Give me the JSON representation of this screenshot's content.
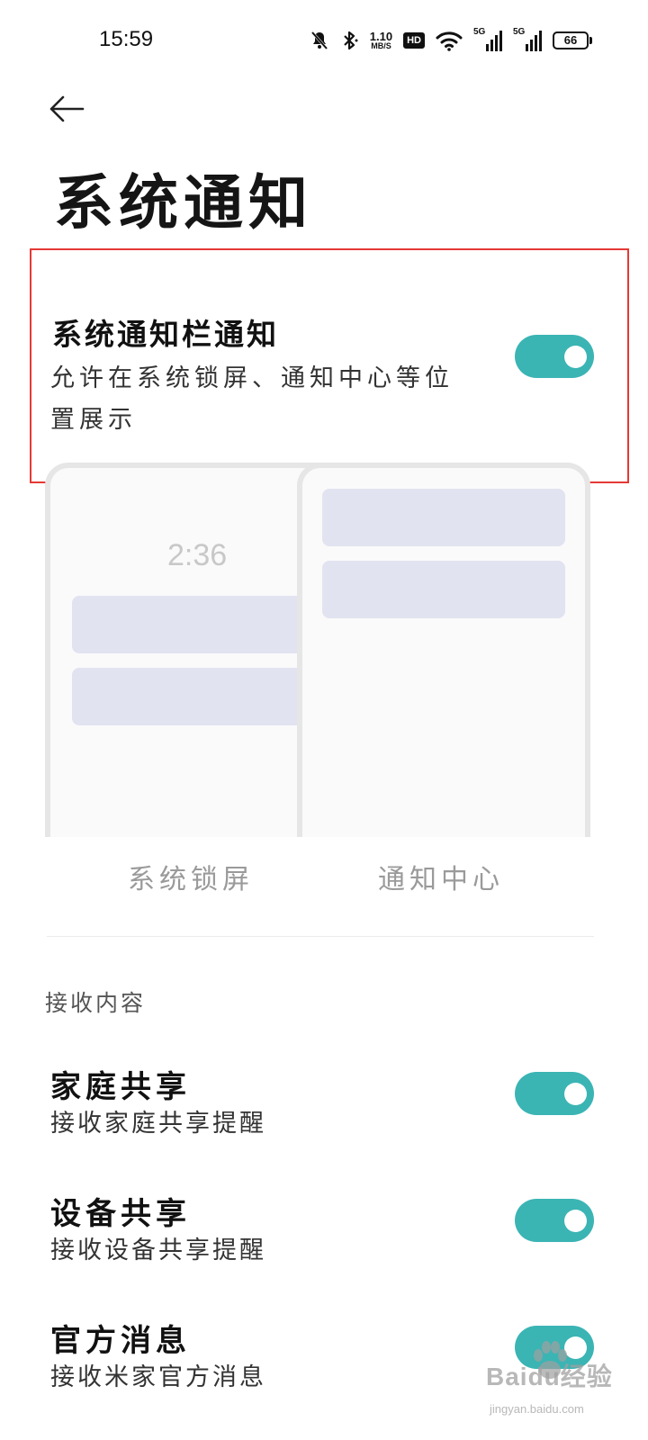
{
  "status_bar": {
    "time": "15:59",
    "net_speed_value": "1.10",
    "net_speed_unit": "MB/S",
    "hd_label": "HD",
    "signal1_label": "5G",
    "signal2_label": "5G",
    "battery": "66",
    "icons": [
      "mute-bell-icon",
      "bluetooth-icon",
      "wifi-icon"
    ]
  },
  "header": {
    "back_icon": "arrow-left-icon",
    "title": "系统通知"
  },
  "main_item": {
    "title": "系统通知栏通知",
    "description": "允许在系统锁屏、通知中心等位置展示",
    "enabled": true
  },
  "preview": {
    "lock_time": "2:36",
    "labels": [
      "系统锁屏",
      "通知中心"
    ]
  },
  "section": {
    "title": "接收内容"
  },
  "items": [
    {
      "title": "家庭共享",
      "subtitle": "接收家庭共享提醒",
      "enabled": true
    },
    {
      "title": "设备共享",
      "subtitle": "接收设备共享提醒",
      "enabled": true
    },
    {
      "title": "官方消息",
      "subtitle": "接收米家官方消息",
      "enabled": true
    }
  ],
  "watermark": {
    "main": "Baidu经验",
    "sub": "jingyan.baidu.com"
  },
  "colors": {
    "toggle_on": "#3bb4b4",
    "highlight_border": "#e53935",
    "card": "#e2e3f1"
  }
}
